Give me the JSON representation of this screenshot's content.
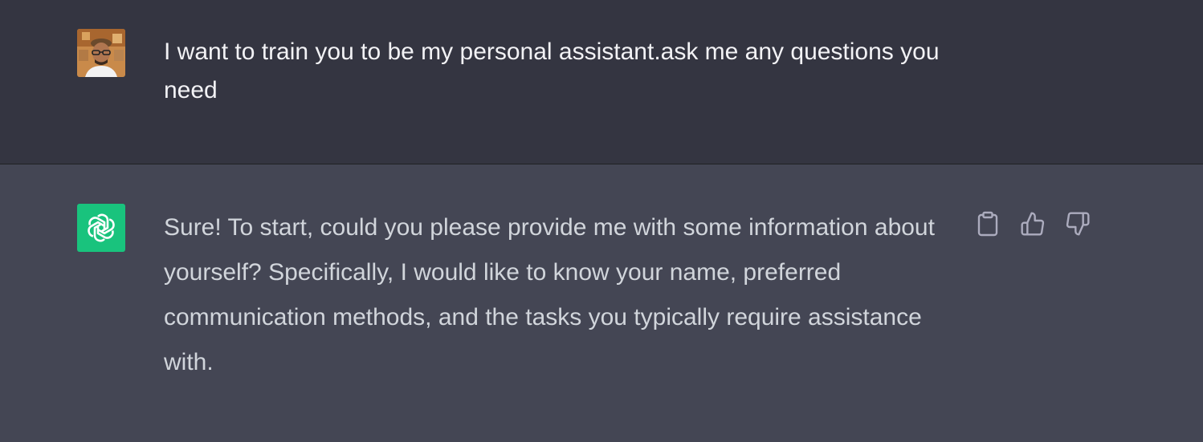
{
  "messages": [
    {
      "role": "user",
      "avatar": "user-avatar-photo",
      "text": "I want to train you to be my personal assistant.ask me any questions you need"
    },
    {
      "role": "assistant",
      "avatar": "openai-logo-icon",
      "text": "Sure! To start, could you please provide me with some information about yourself? Specifically, I would like to know your name, preferred communication methods, and the tasks you typically require assistance with."
    }
  ],
  "actions": {
    "icons": [
      "clipboard-icon",
      "thumbs-up-icon",
      "thumbs-down-icon"
    ]
  },
  "colors": {
    "user_bg": "#343541",
    "assistant_bg": "#444654",
    "assistant_avatar_bg": "#19c37d",
    "text": "#d1d5db"
  }
}
